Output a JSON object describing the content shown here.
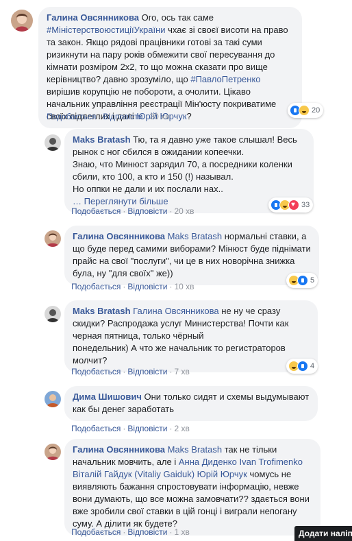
{
  "comments": [
    {
      "author": "Галина Овсянникова",
      "parts": [
        {
          "t": "text",
          "v": " Ого, ось так саме "
        },
        {
          "t": "tag",
          "v": "#МіністерствоюстиціїУкраїни"
        },
        {
          "t": "text",
          "v": " чхає зі своєї висоти на право та закон. Якщо рядові працівники готові за такі суми ризикнути на пару років обмежити свої пересування до кімнати розміром 2х2, то що можна сказати про вище керівництво? давно зрозуміло, що "
        },
        {
          "t": "tag",
          "v": "#ПавлоПетренко"
        },
        {
          "t": "text",
          "v": " вирішив корупцію не побороти, а очолити. Цікаво начальник управління реєстрації Мін'юсту покриватиме своїх підлеглих і далі "
        },
        {
          "t": "tag",
          "v": "Юрій Юрчук"
        },
        {
          "t": "text",
          "v": "?"
        }
      ],
      "actions": {
        "like": "Подобається",
        "reply": "Відповісти",
        "time": "30 хв"
      },
      "reactions": {
        "icons": [
          "like",
          "haha"
        ],
        "count": "20"
      }
    },
    {
      "author": "Maks Bratash",
      "parts": [
        {
          "t": "text",
          "v": " Тю, та я давно уже такое слышал! Весь рынок с ног сбился в ожидании копеечки.\nЗнаю, что Минюст зарядил 70, а посредники коленки сбили, кто 100, а кто и 150 (!) называл.\nНо оппки не дали и их послали нах.."
        },
        {
          "t": "seemore",
          "v": "\n… Переглянути більше"
        }
      ],
      "actions": {
        "like": "Подобається",
        "reply": "Відповісти",
        "time": "20 хв"
      },
      "reactions": {
        "icons": [
          "like",
          "haha",
          "love"
        ],
        "count": "33"
      }
    },
    {
      "author": "Галина Овсянникова",
      "parts": [
        {
          "t": "tag",
          "v": " Maks Bratash"
        },
        {
          "t": "text",
          "v": " нормальні ставки, а що буде перед самими виборами? Мінюст буде піднімати прайс на свої \"послуги\", чи це в них новорічна знижка була, ну \"для своїх\" же))"
        }
      ],
      "actions": {
        "like": "Подобається",
        "reply": "Відповісти",
        "time": "10 хв"
      },
      "reactions": {
        "icons": [
          "haha",
          "like"
        ],
        "count": "5"
      }
    },
    {
      "author": "Maks Bratash",
      "parts": [
        {
          "t": "tag",
          "v": " Галина Овсянникова"
        },
        {
          "t": "text",
          "v": " не ну че сразу скидки? Распродажа услуг Министерства! Почти как черная пятница, только чёрный\nпонедельник) А что же начальник то регистраторов молчит?"
        }
      ],
      "actions": {
        "like": "Подобається",
        "reply": "Відповісти",
        "time": "7 хв"
      },
      "reactions": {
        "icons": [
          "haha",
          "like"
        ],
        "count": "4"
      }
    },
    {
      "author": "Дима Шишович",
      "parts": [
        {
          "t": "text",
          "v": " Они только сидят и схемы выдумывают как бы денег заработать"
        }
      ],
      "actions": {
        "like": "Подобається",
        "reply": "Відповісти",
        "time": "2 хв"
      },
      "reactions": null
    },
    {
      "author": "Галина Овсянникова",
      "parts": [
        {
          "t": "tag",
          "v": " Maks Bratash"
        },
        {
          "t": "text",
          "v": " так не тільки начальник мовчить, але і "
        },
        {
          "t": "tag",
          "v": "Анна Диденко"
        },
        {
          "t": "text",
          "v": " "
        },
        {
          "t": "tag",
          "v": "Ivan Trofimenko"
        },
        {
          "t": "text",
          "v": " "
        },
        {
          "t": "tag",
          "v": "Віталій Гайдук (Vitaliy Gaiduk)"
        },
        {
          "t": "text",
          "v": " "
        },
        {
          "t": "tag",
          "v": "Юрій Юрчук"
        },
        {
          "t": "text",
          "v": " чомусь не виявляють бажання спростовувати інформацію, невже вони думають, що все можна замовчати?? здається вони вже зробили свої ставки в цій гонці і виграли непогану суму. А ділити як будете?"
        }
      ],
      "actions": {
        "like": "Подобається",
        "reply": "Відповісти",
        "time": "1 хв"
      },
      "reactions": null
    }
  ],
  "footer": {
    "add_label": "Додати наліпку"
  },
  "colors": {
    "link": "#385898",
    "bubble": "#f2f3f5",
    "like": "#1877f2",
    "haha": "#f7c84b",
    "love": "#f33e58"
  }
}
